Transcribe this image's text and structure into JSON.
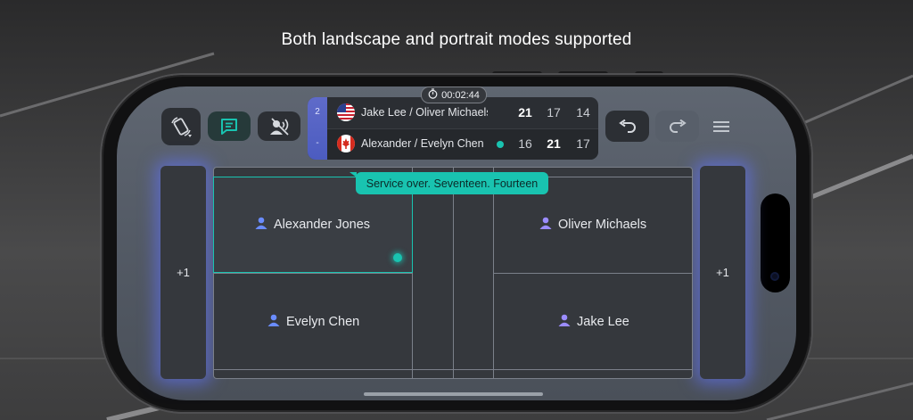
{
  "headline": "Both landscape and portrait modes supported",
  "toolbar": {
    "rotate_icon": "rotate-screen-icon",
    "comments_icon": "comment-list-icon",
    "voice_off_icon": "voice-off-icon",
    "undo_icon": "undo-icon",
    "redo_icon": "redo-icon",
    "menu_icon": "hamburger-menu-icon"
  },
  "timer": "00:02:44",
  "scoreboard": {
    "strip_top": "2",
    "strip_bottom": "-",
    "teams": [
      {
        "flag": "us-flag-icon",
        "name": "Jake Lee / Oliver Michaels",
        "serving": false,
        "scores": [
          "21",
          "17",
          "14"
        ],
        "bold": [
          true,
          false,
          false
        ]
      },
      {
        "flag": "canada-flag-icon",
        "name": "Alexander  / Evelyn Chen",
        "serving": true,
        "scores": [
          "16",
          "21",
          "17"
        ],
        "bold": [
          false,
          true,
          false
        ]
      }
    ]
  },
  "toast": "Service over. Seventeen. Fourteen",
  "left_panel_label": "+1",
  "right_panel_label": "+1",
  "court": {
    "players": {
      "top_left": "Alexander Jones",
      "bottom_left": "Evelyn Chen",
      "top_right": "Oliver Michaels",
      "bottom_right": "Jake Lee"
    },
    "server": "Alexander Jones"
  },
  "colors": {
    "accent_teal": "#19c3b0",
    "glow_blue": "#6070f0",
    "player_icon_left": "#6a8cff",
    "player_icon_right": "#9b8cff"
  }
}
